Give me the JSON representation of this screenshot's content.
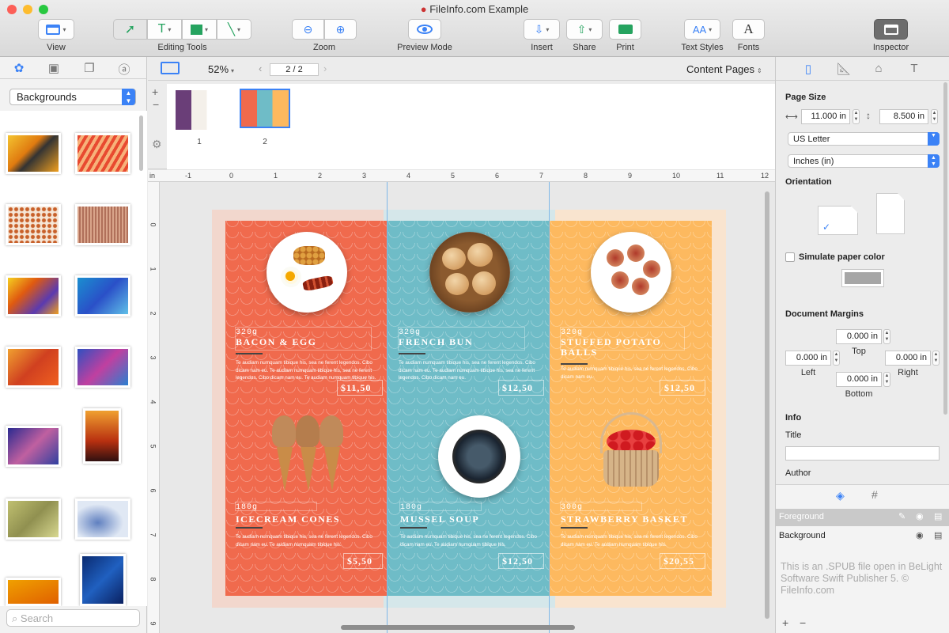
{
  "window": {
    "title": "FileInfo.com Example"
  },
  "toolbar": {
    "view": "View",
    "editing_tools": "Editing Tools",
    "zoom": "Zoom",
    "preview_mode": "Preview Mode",
    "insert": "Insert",
    "share": "Share",
    "print": "Print",
    "text_styles": "Text Styles",
    "fonts": "Fonts",
    "inspector": "Inspector",
    "fonts_glyph": "A",
    "text_styles_glyph": "AA"
  },
  "left_sidebar": {
    "category": "Backgrounds",
    "search_placeholder": "Search"
  },
  "navbar": {
    "zoom": "52%",
    "page_indicator": "2 / 2",
    "page_set": "Content Pages"
  },
  "page_strip": {
    "pages": [
      "1",
      "2"
    ]
  },
  "ruler": {
    "unit": "in",
    "h_ticks": [
      "-1",
      "0",
      "1",
      "2",
      "3",
      "4",
      "5",
      "6",
      "7",
      "8",
      "9",
      "10",
      "11",
      "12"
    ],
    "v_ticks": [
      "0",
      "1",
      "2",
      "3",
      "4",
      "5",
      "6",
      "7",
      "8",
      "9"
    ]
  },
  "brochure": {
    "items": [
      {
        "weight": "320g",
        "name": "BACON & EGG",
        "desc": "Te audiam numquam tibique his, sea ne ferent legendos. Cibo dicam nam eu. Te audiam numquam tibique his, sea ne ferent legendos. Cibo dicam nam eu. Te audiam numquam tibique his.",
        "price": "$11,50"
      },
      {
        "weight": "320g",
        "name": "FRENCH  BUN",
        "desc": "Te audiam numquam tibique his, sea ne ferent legendos. Cibo dicam nam eu. Te audiam numquam tibique his, sea ne ferent legendos. Cibo dicam nam eu.",
        "price": "$12,50"
      },
      {
        "weight": "320g",
        "name": "STUFFED POTATO BALLS",
        "desc": "Te audiam numquam tibique his, sea ne ferent legendos. Cibo dicam nam eu.",
        "price": "$12,50"
      },
      {
        "weight": "180g",
        "name": "ICECREAM CONES",
        "desc": "Te audiam numquam tibique his, sea ne ferent legendos. Cibo dicam nam eu. Te audiam numquam tibique his.",
        "price": "$5,50"
      },
      {
        "weight": "180g",
        "name": "MUSSEL SOUP",
        "desc": "Te audiam numquam tibique his, sea ne ferent legendos. Cibo dicam nam eu. Te audiam numquam tibique his.",
        "price": "$12,50"
      },
      {
        "weight": "300g",
        "name": "STRAWBERRY BASKET",
        "desc": "Te audiam numquam tibique his, sea ne ferent legendos. Cibo dicam nam eu. Te audiam numquam tibique his.",
        "price": "$20,55"
      }
    ],
    "colors": {
      "orange": "#f06a4d",
      "teal": "#6fbcc7",
      "yellow": "#fdb95f"
    }
  },
  "inspector": {
    "page_size": "Page Size",
    "width": "11.000 in",
    "height": "8.500 in",
    "paper": "US Letter",
    "units": "Inches (in)",
    "orientation": "Orientation",
    "simulate_paper": "Simulate paper color",
    "margins_heading": "Document Margins",
    "margin_top": "0.000 in",
    "margin_left": "0.000 in",
    "margin_right": "0.000 in",
    "margin_bottom": "0.000 in",
    "top": "Top",
    "left": "Left",
    "right": "Right",
    "bottom": "Bottom",
    "info": "Info",
    "title_label": "Title",
    "author_label": "Author",
    "layer_foreground": "Foreground",
    "layer_background": "Background",
    "watermark": "This is an .SPUB file open in BeLight Software Swift Publisher 5. © FileInfo.com"
  }
}
